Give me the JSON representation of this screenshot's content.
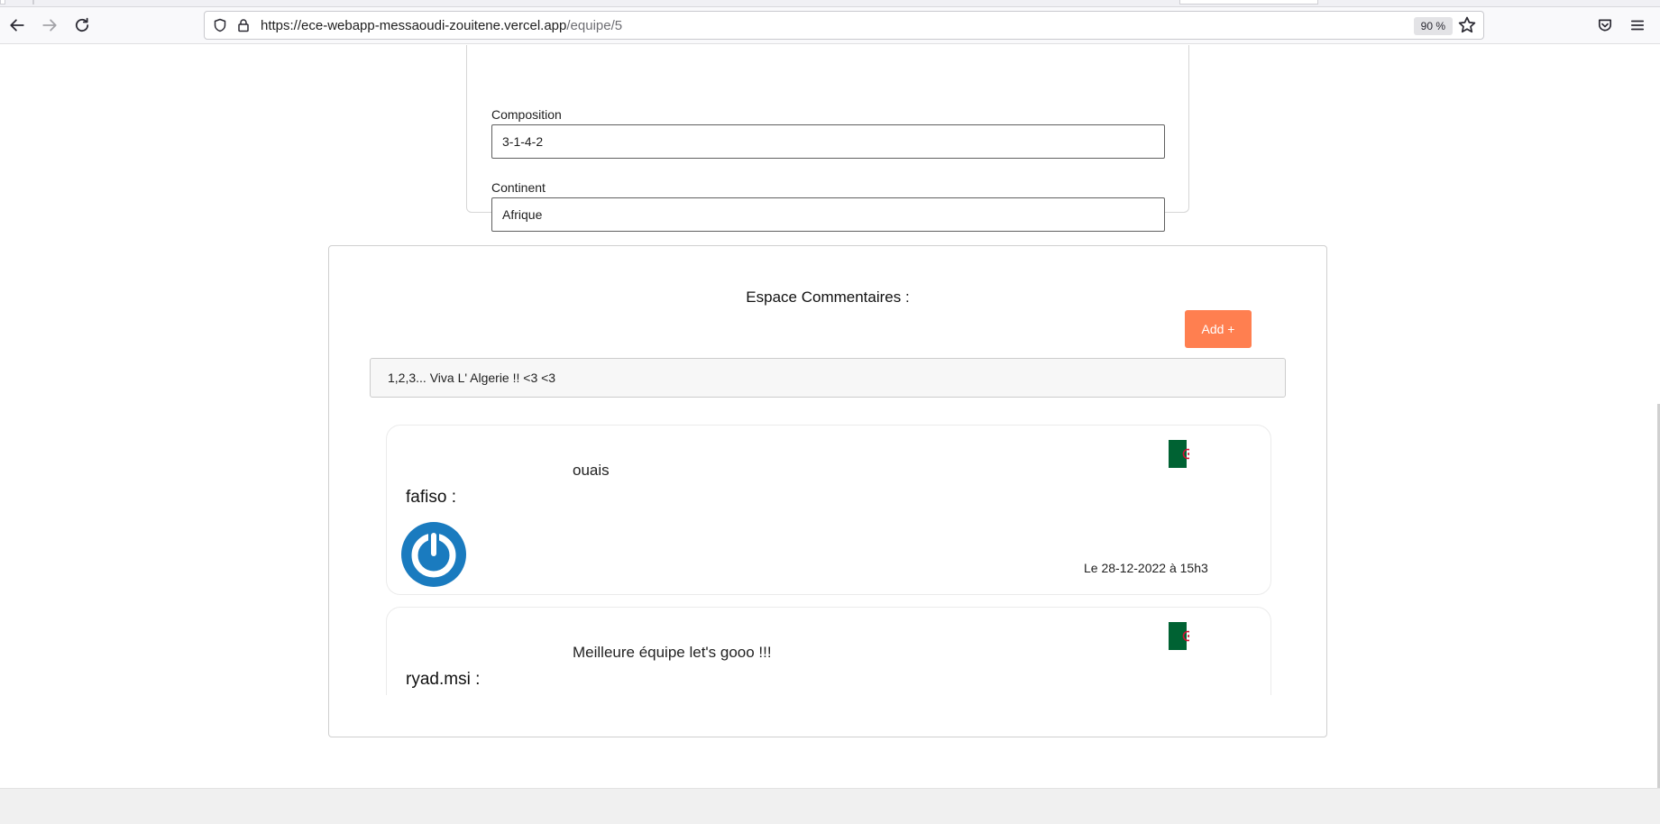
{
  "browser": {
    "url_host": "https://ece-webapp-messaoudi-zouitene.vercel.app",
    "url_path": "/equipe/5",
    "zoom": "90 %",
    "icons": {
      "back": "arrow-left-icon",
      "forward": "arrow-right-icon",
      "reload": "reload-icon",
      "shield": "shield-icon",
      "lock": "lock-icon",
      "bookmark": "star-icon",
      "pocket": "pocket-icon",
      "menu": "hamburger-menu-icon"
    }
  },
  "team": {
    "composition_label": "Composition",
    "composition_value": "3-1-4-2",
    "continent_label": "Continent",
    "continent_value": "Afrique"
  },
  "comments": {
    "title": "Espace Commentaires :",
    "add_label": "Add +",
    "input_value": "1,2,3... Viva L' Algerie !! <3 <3",
    "items": [
      {
        "text": "ouais",
        "author": "fafiso :",
        "date": "Le 28-12-2022 à 15h3",
        "flag": "algeria-flag-icon",
        "avatar": "power-avatar-icon"
      },
      {
        "text": "Meilleure équipe let's gooo !!!",
        "author": "ryad.msi :",
        "flag": "algeria-flag-icon"
      }
    ]
  },
  "colors": {
    "accent": "#ff7f50",
    "flag_green": "#006233",
    "flag_red": "#d21034",
    "avatar_blue": "#1a7bbf"
  }
}
